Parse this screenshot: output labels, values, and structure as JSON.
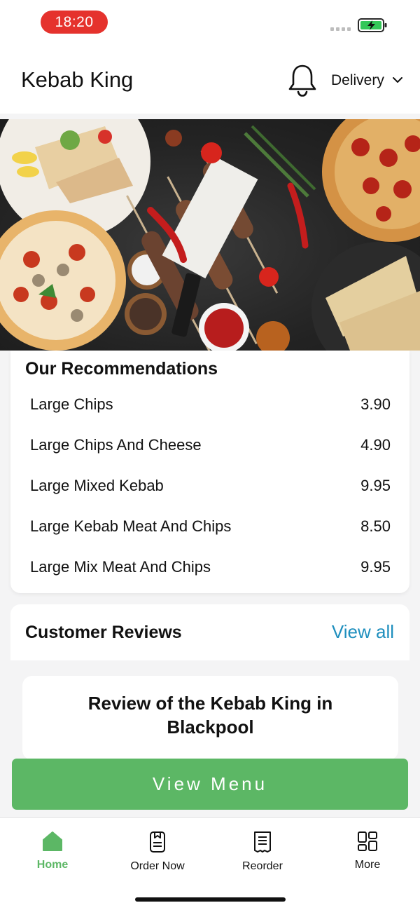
{
  "status_bar": {
    "time": "18:20"
  },
  "header": {
    "title": "Kebab King",
    "delivery_label": "Delivery"
  },
  "recommendations": {
    "title": "Our Recommendations",
    "items": [
      {
        "name": "Large Chips",
        "price": "3.90"
      },
      {
        "name": "Large Chips And Cheese",
        "price": "4.90"
      },
      {
        "name": "Large Mixed Kebab",
        "price": "9.95"
      },
      {
        "name": "Large Kebab Meat And Chips",
        "price": "8.50"
      },
      {
        "name": "Large Mix Meat And Chips",
        "price": "9.95"
      }
    ]
  },
  "reviews": {
    "title": "Customer Reviews",
    "view_all": "View all",
    "first_review_title": "Review of the Kebab King in Blackpool"
  },
  "cta": {
    "view_menu": "View Menu"
  },
  "tabs": [
    {
      "label": "Home",
      "icon": "home-icon"
    },
    {
      "label": "Order Now",
      "icon": "order-icon"
    },
    {
      "label": "Reorder",
      "icon": "receipt-icon"
    },
    {
      "label": "More",
      "icon": "grid-icon"
    }
  ],
  "colors": {
    "accent_green": "#5cb765",
    "link_blue": "#1f8fbe",
    "time_pill_red": "#e5322d"
  }
}
